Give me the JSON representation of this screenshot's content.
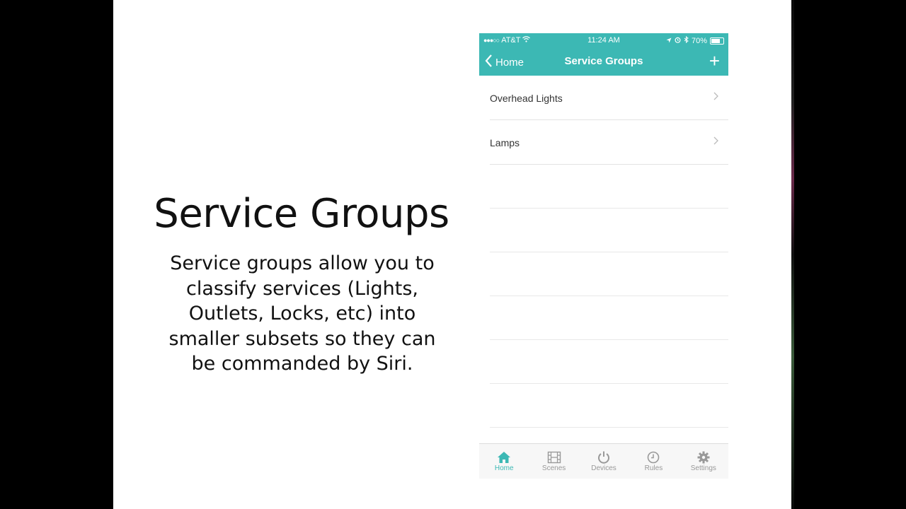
{
  "slide": {
    "title": "Service Groups",
    "body": "Service groups allow you to classify services (Lights, Outlets, Locks, etc) into smaller subsets so they can be commanded by Siri."
  },
  "status_bar": {
    "carrier": "AT&T",
    "time": "11:24 AM",
    "battery": "70%"
  },
  "nav": {
    "back_label": "Home",
    "title": "Service Groups",
    "add_label": "+"
  },
  "groups": [
    {
      "label": "Overhead Lights"
    },
    {
      "label": "Lamps"
    }
  ],
  "tabs": [
    {
      "label": "Home",
      "icon": "home-icon"
    },
    {
      "label": "Scenes",
      "icon": "film-icon"
    },
    {
      "label": "Devices",
      "icon": "power-icon"
    },
    {
      "label": "Rules",
      "icon": "clock-icon"
    },
    {
      "label": "Settings",
      "icon": "gear-icon"
    }
  ],
  "colors": {
    "accent": "#3cb8b4",
    "inactive_tab": "#999999"
  }
}
